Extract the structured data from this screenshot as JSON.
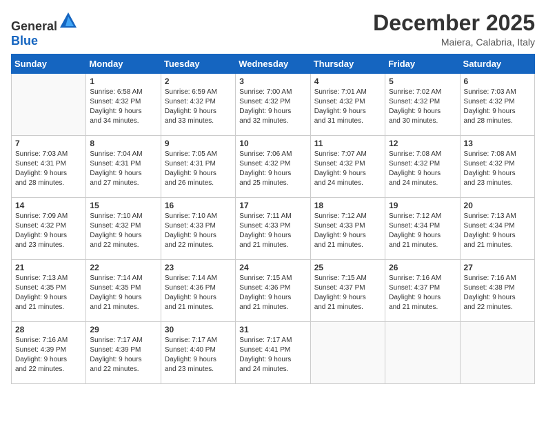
{
  "header": {
    "logo": {
      "text_general": "General",
      "text_blue": "Blue"
    },
    "title": "December 2025",
    "location": "Maiera, Calabria, Italy"
  },
  "calendar": {
    "weekdays": [
      "Sunday",
      "Monday",
      "Tuesday",
      "Wednesday",
      "Thursday",
      "Friday",
      "Saturday"
    ],
    "weeks": [
      [
        {
          "day": "",
          "info": ""
        },
        {
          "day": "1",
          "info": "Sunrise: 6:58 AM\nSunset: 4:32 PM\nDaylight: 9 hours\nand 34 minutes."
        },
        {
          "day": "2",
          "info": "Sunrise: 6:59 AM\nSunset: 4:32 PM\nDaylight: 9 hours\nand 33 minutes."
        },
        {
          "day": "3",
          "info": "Sunrise: 7:00 AM\nSunset: 4:32 PM\nDaylight: 9 hours\nand 32 minutes."
        },
        {
          "day": "4",
          "info": "Sunrise: 7:01 AM\nSunset: 4:32 PM\nDaylight: 9 hours\nand 31 minutes."
        },
        {
          "day": "5",
          "info": "Sunrise: 7:02 AM\nSunset: 4:32 PM\nDaylight: 9 hours\nand 30 minutes."
        },
        {
          "day": "6",
          "info": "Sunrise: 7:03 AM\nSunset: 4:32 PM\nDaylight: 9 hours\nand 28 minutes."
        }
      ],
      [
        {
          "day": "7",
          "info": "Sunrise: 7:03 AM\nSunset: 4:31 PM\nDaylight: 9 hours\nand 28 minutes."
        },
        {
          "day": "8",
          "info": "Sunrise: 7:04 AM\nSunset: 4:31 PM\nDaylight: 9 hours\nand 27 minutes."
        },
        {
          "day": "9",
          "info": "Sunrise: 7:05 AM\nSunset: 4:31 PM\nDaylight: 9 hours\nand 26 minutes."
        },
        {
          "day": "10",
          "info": "Sunrise: 7:06 AM\nSunset: 4:32 PM\nDaylight: 9 hours\nand 25 minutes."
        },
        {
          "day": "11",
          "info": "Sunrise: 7:07 AM\nSunset: 4:32 PM\nDaylight: 9 hours\nand 24 minutes."
        },
        {
          "day": "12",
          "info": "Sunrise: 7:08 AM\nSunset: 4:32 PM\nDaylight: 9 hours\nand 24 minutes."
        },
        {
          "day": "13",
          "info": "Sunrise: 7:08 AM\nSunset: 4:32 PM\nDaylight: 9 hours\nand 23 minutes."
        }
      ],
      [
        {
          "day": "14",
          "info": "Sunrise: 7:09 AM\nSunset: 4:32 PM\nDaylight: 9 hours\nand 23 minutes."
        },
        {
          "day": "15",
          "info": "Sunrise: 7:10 AM\nSunset: 4:32 PM\nDaylight: 9 hours\nand 22 minutes."
        },
        {
          "day": "16",
          "info": "Sunrise: 7:10 AM\nSunset: 4:33 PM\nDaylight: 9 hours\nand 22 minutes."
        },
        {
          "day": "17",
          "info": "Sunrise: 7:11 AM\nSunset: 4:33 PM\nDaylight: 9 hours\nand 21 minutes."
        },
        {
          "day": "18",
          "info": "Sunrise: 7:12 AM\nSunset: 4:33 PM\nDaylight: 9 hours\nand 21 minutes."
        },
        {
          "day": "19",
          "info": "Sunrise: 7:12 AM\nSunset: 4:34 PM\nDaylight: 9 hours\nand 21 minutes."
        },
        {
          "day": "20",
          "info": "Sunrise: 7:13 AM\nSunset: 4:34 PM\nDaylight: 9 hours\nand 21 minutes."
        }
      ],
      [
        {
          "day": "21",
          "info": "Sunrise: 7:13 AM\nSunset: 4:35 PM\nDaylight: 9 hours\nand 21 minutes."
        },
        {
          "day": "22",
          "info": "Sunrise: 7:14 AM\nSunset: 4:35 PM\nDaylight: 9 hours\nand 21 minutes."
        },
        {
          "day": "23",
          "info": "Sunrise: 7:14 AM\nSunset: 4:36 PM\nDaylight: 9 hours\nand 21 minutes."
        },
        {
          "day": "24",
          "info": "Sunrise: 7:15 AM\nSunset: 4:36 PM\nDaylight: 9 hours\nand 21 minutes."
        },
        {
          "day": "25",
          "info": "Sunrise: 7:15 AM\nSunset: 4:37 PM\nDaylight: 9 hours\nand 21 minutes."
        },
        {
          "day": "26",
          "info": "Sunrise: 7:16 AM\nSunset: 4:37 PM\nDaylight: 9 hours\nand 21 minutes."
        },
        {
          "day": "27",
          "info": "Sunrise: 7:16 AM\nSunset: 4:38 PM\nDaylight: 9 hours\nand 22 minutes."
        }
      ],
      [
        {
          "day": "28",
          "info": "Sunrise: 7:16 AM\nSunset: 4:39 PM\nDaylight: 9 hours\nand 22 minutes."
        },
        {
          "day": "29",
          "info": "Sunrise: 7:17 AM\nSunset: 4:39 PM\nDaylight: 9 hours\nand 22 minutes."
        },
        {
          "day": "30",
          "info": "Sunrise: 7:17 AM\nSunset: 4:40 PM\nDaylight: 9 hours\nand 23 minutes."
        },
        {
          "day": "31",
          "info": "Sunrise: 7:17 AM\nSunset: 4:41 PM\nDaylight: 9 hours\nand 24 minutes."
        },
        {
          "day": "",
          "info": ""
        },
        {
          "day": "",
          "info": ""
        },
        {
          "day": "",
          "info": ""
        }
      ]
    ]
  }
}
